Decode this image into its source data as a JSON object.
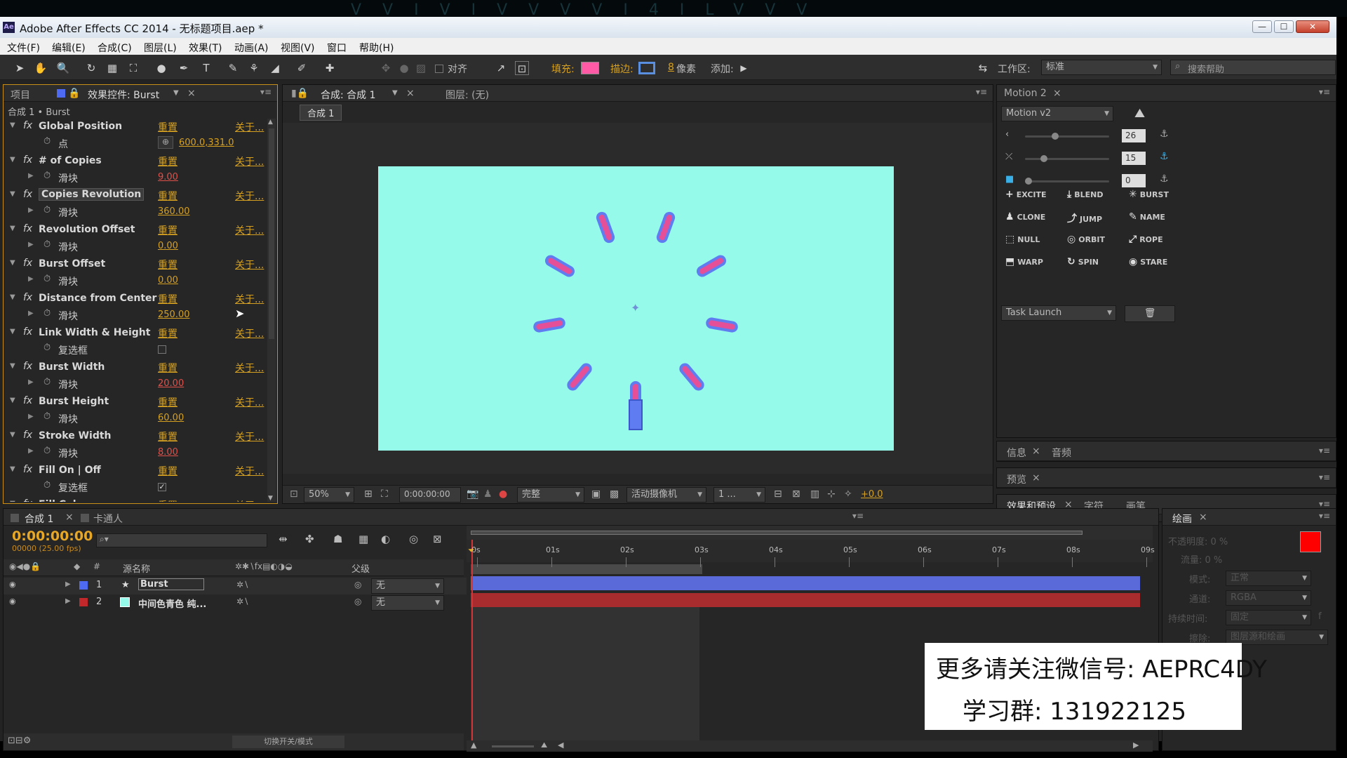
{
  "app": {
    "title": "Adobe After Effects CC 2014 - 无标题项目.aep *",
    "icon": "Ae",
    "top_strip": "VVIVIVVVVI4ILVVV"
  },
  "window_controls": {
    "minimize": "—",
    "maximize": "☐",
    "close": "✕"
  },
  "menu": [
    "文件(F)",
    "编辑(E)",
    "合成(C)",
    "图层(L)",
    "效果(T)",
    "动画(A)",
    "视图(V)",
    "窗口",
    "帮助(H)"
  ],
  "toolbar": {
    "align_label": "对齐",
    "fill_label": "填充:",
    "fill_color": "#ff5aa5",
    "stroke_label": "描边:",
    "stroke_width": "8",
    "stroke_unit": "像素",
    "add_label": "添加:",
    "workspace_label": "工作区:",
    "workspace_value": "标准",
    "search_placeholder": "搜索帮助"
  },
  "effects_panel": {
    "tab_project": "项目",
    "tab_effects": "效果控件: Burst",
    "breadcrumb": "合成 1 • Burst",
    "reset": "重置",
    "about": "关于...",
    "effects": [
      {
        "name": "Global Position",
        "sub": "点",
        "value": "600.0,331.0",
        "type": "point"
      },
      {
        "name": "# of Copies",
        "sub": "滑块",
        "value": "9.00",
        "type": "slider",
        "red": true
      },
      {
        "name": "Copies Revolution",
        "sub": "滑块",
        "value": "360.00",
        "type": "slider",
        "highlight": true
      },
      {
        "name": "Revolution Offset",
        "sub": "滑块",
        "value": "0.00",
        "type": "slider"
      },
      {
        "name": "Burst Offset",
        "sub": "滑块",
        "value": "0.00",
        "type": "slider"
      },
      {
        "name": "Distance from Center",
        "sub": "滑块",
        "value": "250.00",
        "type": "slider"
      },
      {
        "name": "Link Width & Height",
        "sub": "复选框",
        "value": "",
        "type": "checkbox",
        "checked": false
      },
      {
        "name": "Burst Width",
        "sub": "滑块",
        "value": "20.00",
        "type": "slider",
        "red": true
      },
      {
        "name": "Burst Height",
        "sub": "滑块",
        "value": "60.00",
        "type": "slider"
      },
      {
        "name": "Stroke Width",
        "sub": "滑块",
        "value": "8.00",
        "type": "slider",
        "red": true
      },
      {
        "name": "Fill On | Off",
        "sub": "复选框",
        "value": "",
        "type": "checkbox",
        "checked": true
      },
      {
        "name": "Fill Color",
        "sub": "",
        "value": "",
        "type": "partial"
      }
    ]
  },
  "comp_panel": {
    "tab_comp": "合成: 合成 1",
    "tab_layer": "图层: (无)",
    "comp_chip": "合成 1",
    "zoom": "50%",
    "timecode": "0:00:00:00",
    "quality": "完整",
    "camera": "活动摄像机",
    "views": "1 ...",
    "exposure": "+0.0"
  },
  "motion_panel": {
    "tab": "Motion 2",
    "version": "Motion v2",
    "sliders": [
      {
        "value": "26",
        "level": 0.32
      },
      {
        "value": "15",
        "level": 0.18
      },
      {
        "value": "0",
        "level": 0.0
      }
    ],
    "buttons": [
      {
        "label": "EXCITE",
        "icon": "+"
      },
      {
        "label": "BLEND",
        "icon": "⤓"
      },
      {
        "label": "BURST",
        "icon": "✳"
      },
      {
        "label": "CLONE",
        "icon": "♟"
      },
      {
        "label": "JUMP",
        "icon": "⤴"
      },
      {
        "label": "NAME",
        "icon": "✎"
      },
      {
        "label": "NULL",
        "icon": "⬚"
      },
      {
        "label": "ORBIT",
        "icon": "◎"
      },
      {
        "label": "ROPE",
        "icon": "⤢"
      },
      {
        "label": "WARP",
        "icon": "⬒"
      },
      {
        "label": "SPIN",
        "icon": "↻"
      },
      {
        "label": "STARE",
        "icon": "◉"
      }
    ],
    "task_launch": "Task Launch",
    "trash_icon": "🗑"
  },
  "side_panels": {
    "info": "信息",
    "audio": "音频",
    "preview": "预览",
    "effects_presets": "效果和预设",
    "character": "字符",
    "brush": "画笔"
  },
  "timeline": {
    "tab_comp": "合成 1",
    "tab_toonboom": "卡通人",
    "timecode": "0:00:00:00",
    "fps": "00000 (25.00 fps)",
    "col_source": "源名称",
    "col_parent": "父级",
    "col_num": "#",
    "layers": [
      {
        "num": "1",
        "name": "Burst",
        "color": "#4f6af2",
        "parent": "无"
      },
      {
        "num": "2",
        "name": "中间色青色 纯...",
        "color": "#c0282c",
        "swatch": "#96faea",
        "parent": "无"
      }
    ],
    "ruler": [
      "0s",
      "01s",
      "02s",
      "03s",
      "04s",
      "05s",
      "06s",
      "07s",
      "08s",
      "09s"
    ],
    "toggle_label": "切换开关/模式"
  },
  "paint_panel": {
    "tab": "绘画",
    "opacity_label": "不透明度:",
    "opacity_value": "0 %",
    "flow_label": "流量:",
    "flow_value": "0 %",
    "mode_label": "模式:",
    "mode_value": "正常",
    "channel_label": "通道:",
    "channel_value": "RGBA",
    "duration_label": "持续时间:",
    "duration_value": "固定",
    "erase_label": "擦除:",
    "erase_value": "图层源和绘画",
    "f_label": "f"
  },
  "watermark": {
    "line1": "更多请关注微信号: AEPRC4DY",
    "line2": "学习群: 131922125"
  }
}
